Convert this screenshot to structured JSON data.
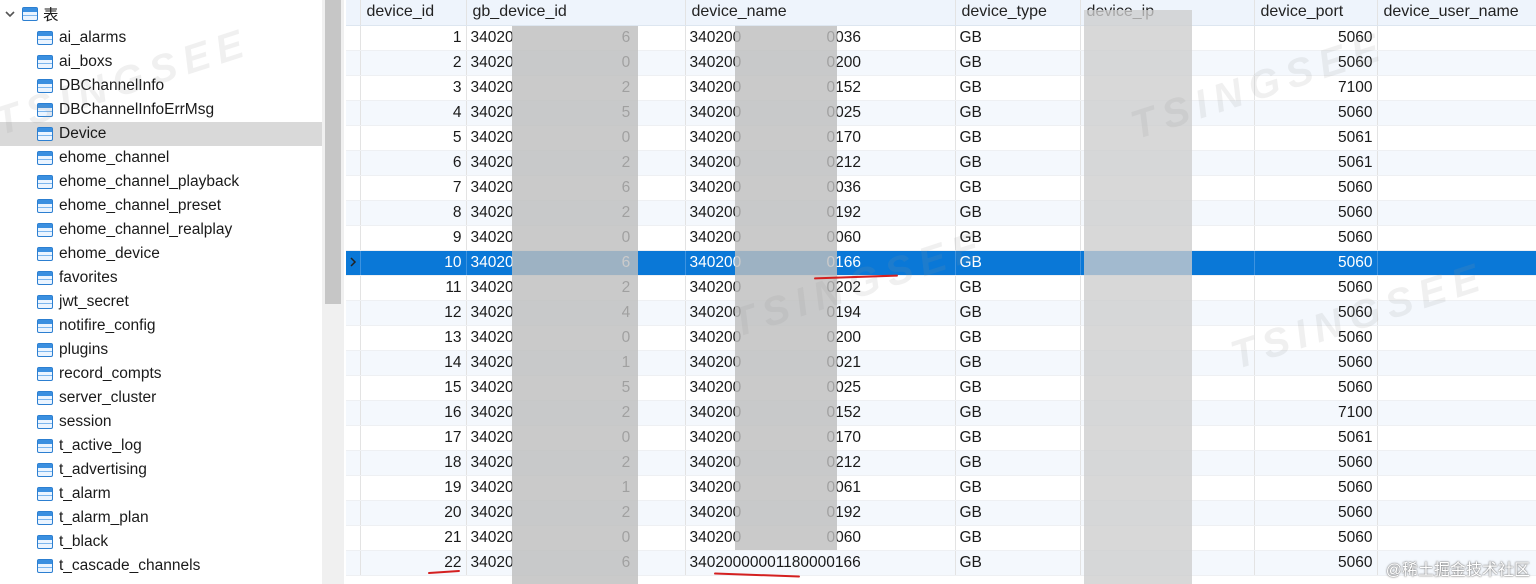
{
  "sidebar": {
    "root_label": "表",
    "items": [
      "ai_alarms",
      "ai_boxs",
      "DBChannelInfo",
      "DBChannelInfoErrMsg",
      "Device",
      "ehome_channel",
      "ehome_channel_playback",
      "ehome_channel_preset",
      "ehome_channel_realplay",
      "ehome_device",
      "favorites",
      "jwt_secret",
      "notifire_config",
      "plugins",
      "record_compts",
      "server_cluster",
      "session",
      "t_active_log",
      "t_advertising",
      "t_alarm",
      "t_alarm_plan",
      "t_black",
      "t_cascade_channels"
    ],
    "selected": "Device"
  },
  "grid": {
    "columns": [
      "device_id",
      "gb_device_id",
      "device_name",
      "device_type",
      "device_ip",
      "device_port",
      "device_user_name"
    ],
    "selected_row": 10,
    "rows": [
      {
        "id": "1",
        "gb": "34020",
        "gb_tail": "6",
        "name": "340200",
        "name_tail": "0036",
        "type": "GB",
        "port": "5060"
      },
      {
        "id": "2",
        "gb": "34020",
        "gb_tail": "0",
        "name": "340200",
        "name_tail": "0200",
        "type": "GB",
        "port": "5060"
      },
      {
        "id": "3",
        "gb": "34020",
        "gb_tail": "2",
        "name": "340200",
        "name_tail": "0152",
        "type": "GB",
        "port": "7100"
      },
      {
        "id": "4",
        "gb": "34020",
        "gb_tail": "5",
        "name": "340200",
        "name_tail": "0025",
        "type": "GB",
        "port": "5060"
      },
      {
        "id": "5",
        "gb": "34020",
        "gb_tail": "0",
        "name": "340200",
        "name_tail": "0170",
        "type": "GB",
        "port": "5061"
      },
      {
        "id": "6",
        "gb": "34020",
        "gb_tail": "2",
        "name": "340200",
        "name_tail": "0212",
        "type": "GB",
        "port": "5061"
      },
      {
        "id": "7",
        "gb": "34020",
        "gb_tail": "6",
        "name": "340200",
        "name_tail": "0036",
        "type": "GB",
        "port": "5060"
      },
      {
        "id": "8",
        "gb": "34020",
        "gb_tail": "2",
        "name": "340200",
        "name_tail": "0192",
        "type": "GB",
        "port": "5060"
      },
      {
        "id": "9",
        "gb": "34020",
        "gb_tail": "0",
        "name": "340200",
        "name_tail": "0060",
        "type": "GB",
        "port": "5060"
      },
      {
        "id": "10",
        "gb": "34020",
        "gb_tail": "6",
        "name": "340200",
        "name_tail": "0166",
        "type": "GB",
        "port": "5060"
      },
      {
        "id": "11",
        "gb": "34020",
        "gb_tail": "2",
        "name": "340200",
        "name_tail": "0202",
        "type": "GB",
        "port": "5060"
      },
      {
        "id": "12",
        "gb": "34020",
        "gb_tail": "4",
        "name": "340200",
        "name_tail": "0194",
        "type": "GB",
        "port": "5060"
      },
      {
        "id": "13",
        "gb": "34020",
        "gb_tail": "0",
        "name": "340200",
        "name_tail": "0200",
        "type": "GB",
        "port": "5060"
      },
      {
        "id": "14",
        "gb": "34020",
        "gb_tail": "1",
        "name": "340200",
        "name_tail": "0021",
        "type": "GB",
        "port": "5060"
      },
      {
        "id": "15",
        "gb": "34020",
        "gb_tail": "5",
        "name": "340200",
        "name_tail": "0025",
        "type": "GB",
        "port": "5060"
      },
      {
        "id": "16",
        "gb": "34020",
        "gb_tail": "2",
        "name": "340200",
        "name_tail": "0152",
        "type": "GB",
        "port": "7100"
      },
      {
        "id": "17",
        "gb": "34020",
        "gb_tail": "0",
        "name": "340200",
        "name_tail": "0170",
        "type": "GB",
        "port": "5061"
      },
      {
        "id": "18",
        "gb": "34020",
        "gb_tail": "2",
        "name": "340200",
        "name_tail": "0212",
        "type": "GB",
        "port": "5060"
      },
      {
        "id": "19",
        "gb": "34020",
        "gb_tail": "1",
        "name": "340200",
        "name_tail": "0061",
        "type": "GB",
        "port": "5060"
      },
      {
        "id": "20",
        "gb": "34020",
        "gb_tail": "2",
        "name": "340200",
        "name_tail": "0192",
        "type": "GB",
        "port": "5060"
      },
      {
        "id": "21",
        "gb": "34020",
        "gb_tail": "0",
        "name": "340200",
        "name_tail": "0060",
        "type": "GB",
        "port": "5060"
      },
      {
        "id": "22",
        "gb": "34020",
        "gb_tail": "6",
        "name": "3402000000118",
        "name_tail": "0000166",
        "type": "GB",
        "port": "5060"
      }
    ]
  },
  "watermarks": {
    "brand": "TSINGSEE",
    "corner": "@稀土掘金技术社区"
  },
  "colors": {
    "selection": "#0a78d7",
    "annotation": "#d42020",
    "icon": "#2c7fd1"
  }
}
